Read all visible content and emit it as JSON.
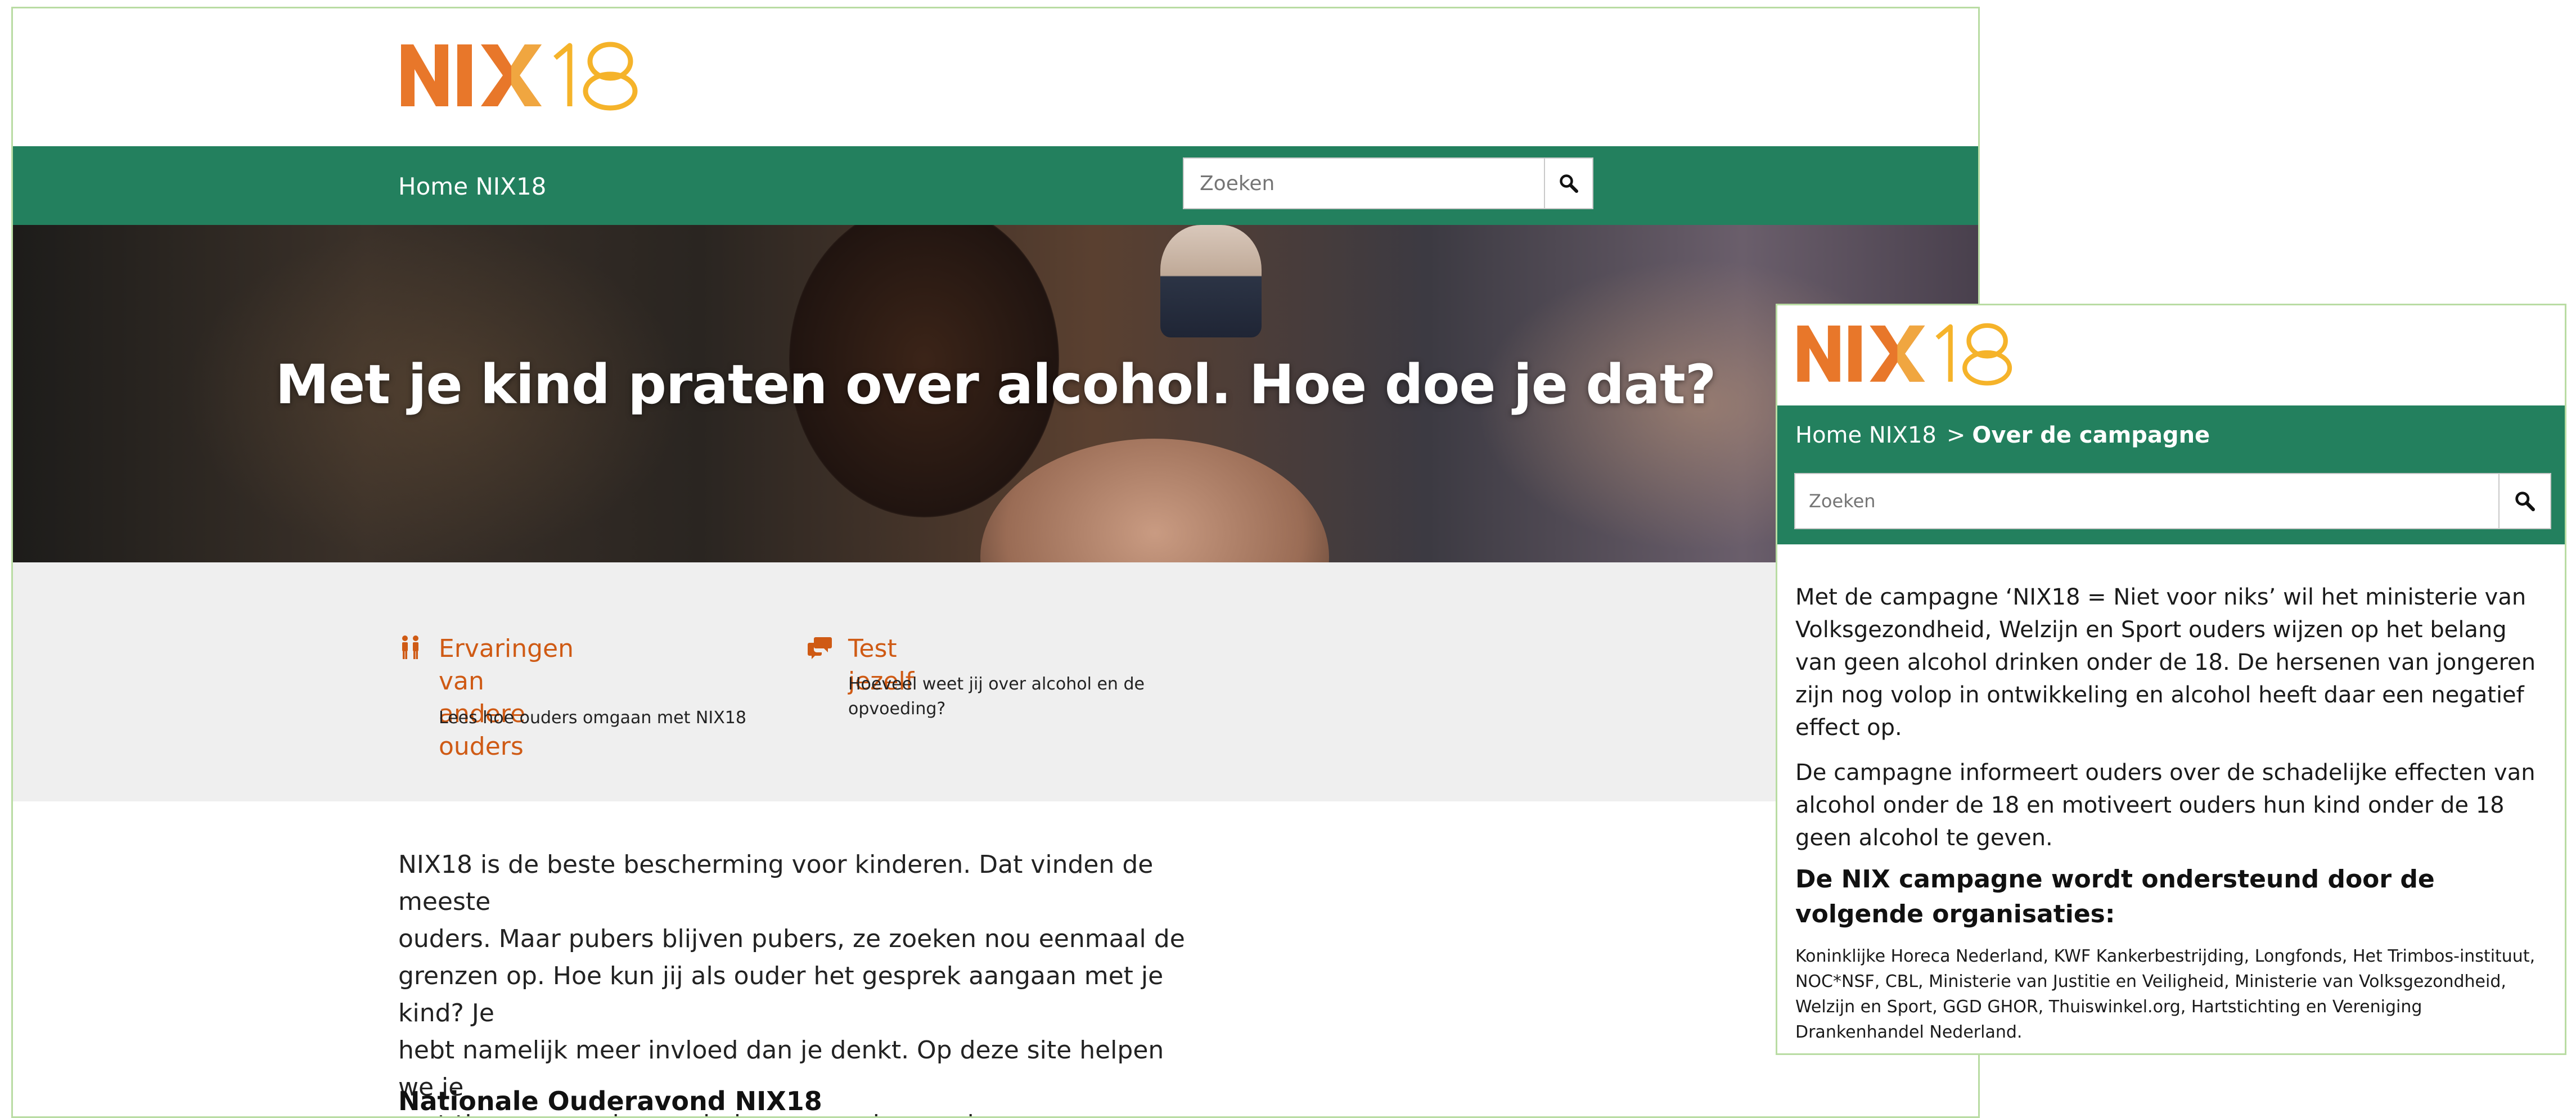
{
  "brand": {
    "logo_text": "NIX18",
    "accent": "#e8772a",
    "accent_light": "#f5b32a",
    "nav_green": "#23805e",
    "link_orange": "#cf5a14"
  },
  "nav": {
    "home_label": "Home NIX18"
  },
  "search": {
    "placeholder": "Zoeken",
    "button_icon": "search-icon"
  },
  "hero": {
    "title": "Met je kind praten over alcohol. Hoe doe je dat?"
  },
  "tiles": [
    {
      "icon": "parents-icon",
      "title_line1": "Ervaringen van andere",
      "title_line2": "ouders",
      "desc": "Lees hoe ouders omgaan met NIX18"
    },
    {
      "icon": "chat-icon",
      "title_line1": "Test jezelf",
      "desc_line1": "Hoeveel weet jij over alcohol en de",
      "desc_line2": "opvoeding?"
    }
  ],
  "body": {
    "lines": [
      "NIX18 is de beste bescherming voor kinderen. Dat vinden de meeste",
      "ouders. Maar pubers blijven pubers, ze zoeken nou eenmaal de",
      "grenzen op. Hoe kun jij als ouder het gesprek aangaan met je kind? Je",
      "hebt namelijk meer invloed dan je denkt. Op deze site helpen we je",
      "met tips en ervaringsverhalen van andere ouders."
    ],
    "section_heading": "Nationale Ouderavond NIX18"
  },
  "mobile": {
    "breadcrumb_home": "Home NIX18",
    "breadcrumb_sep": ">",
    "breadcrumb_current": "Over de campagne",
    "search_placeholder": "Zoeken",
    "para1": "Met de campagne ‘NIX18 = Niet voor niks’ wil het ministerie van Volksgezondheid, Welzijn en Sport ouders wijzen op het belang van geen alcohol drinken onder de 18. De hersenen van jongeren zijn nog volop in ontwikkeling en alcohol heeft daar een negatief effect op.",
    "para2": "De campagne informeert ouders over de schadelijke effecten van alcohol onder de 18 en motiveert ouders hun kind onder de 18 geen alcohol te geven.",
    "heading": "De NIX campagne wordt ondersteund door de volgende organisaties:",
    "orgs": "Koninklijke Horeca Nederland, KWF Kankerbestrijding, Longfonds, Het Trimbos-instituut, NOC*NSF, CBL, Ministerie van Justitie en Veiligheid, Ministerie van Volksgezondheid, Welzijn en Sport, GGD GHOR, Thuiswinkel.org, Hartstichting en Vereniging Drankenhandel Nederland."
  }
}
